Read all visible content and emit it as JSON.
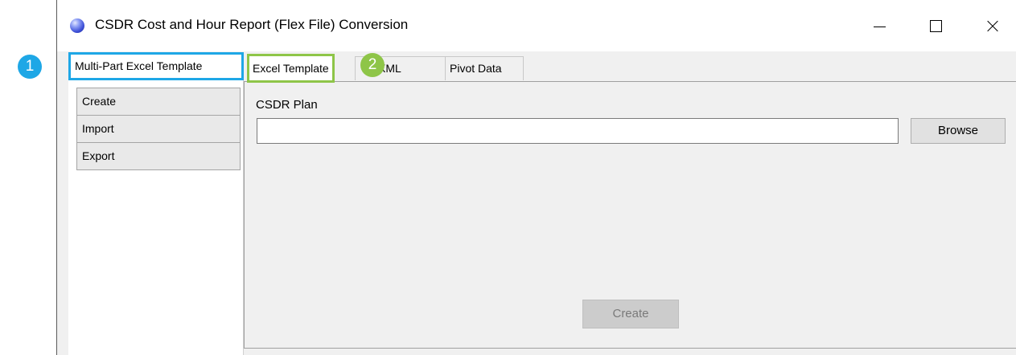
{
  "window": {
    "title": "CSDR Cost and Hour Report (Flex File) Conversion",
    "icon": "globe-icon"
  },
  "callouts": [
    {
      "number": "1",
      "color": "#1ea7e6"
    },
    {
      "number": "2",
      "color": "#8ec548"
    }
  ],
  "outer_tabs": {
    "active_label": "Multi-Part Excel Template"
  },
  "inner_tabs": [
    {
      "label": "Excel Template",
      "active": true
    },
    {
      "label": "R XML",
      "active": false
    },
    {
      "label": "Pivot Data",
      "active": false
    }
  ],
  "sidebar": {
    "items": [
      {
        "label": "Create"
      },
      {
        "label": "Import"
      },
      {
        "label": "Export"
      }
    ]
  },
  "form": {
    "plan_label": "CSDR Plan",
    "plan_value": "",
    "browse_label": "Browse",
    "create_label": "Create"
  },
  "colors": {
    "outer_highlight": "#1ea7e6",
    "inner_highlight": "#8ec548"
  }
}
